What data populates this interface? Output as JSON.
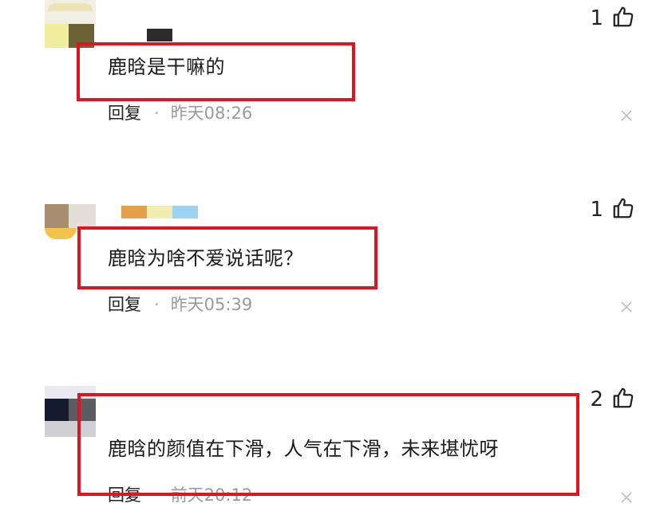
{
  "colors": {
    "highlight": "#e0141e",
    "time_gray": "#9a9a9a"
  },
  "comments": [
    {
      "text": "鹿晗是干嘛的",
      "reply_label": "回复",
      "separator": "·",
      "time": "昨天08:26",
      "likes": "1",
      "like_icon": "thumbs-up-icon",
      "close_icon": "close-icon"
    },
    {
      "text": "鹿晗为啥不爱说话呢？",
      "reply_label": "回复",
      "separator": "·",
      "time": "昨天05:39",
      "likes": "1",
      "like_icon": "thumbs-up-icon",
      "close_icon": "close-icon"
    },
    {
      "text": "鹿晗的颜值在下滑，人气在下滑，未来堪忧呀",
      "reply_label": "回复",
      "separator": "·",
      "time": "前天20:12",
      "likes": "2",
      "like_icon": "thumbs-up-icon",
      "close_icon": "close-icon"
    }
  ]
}
